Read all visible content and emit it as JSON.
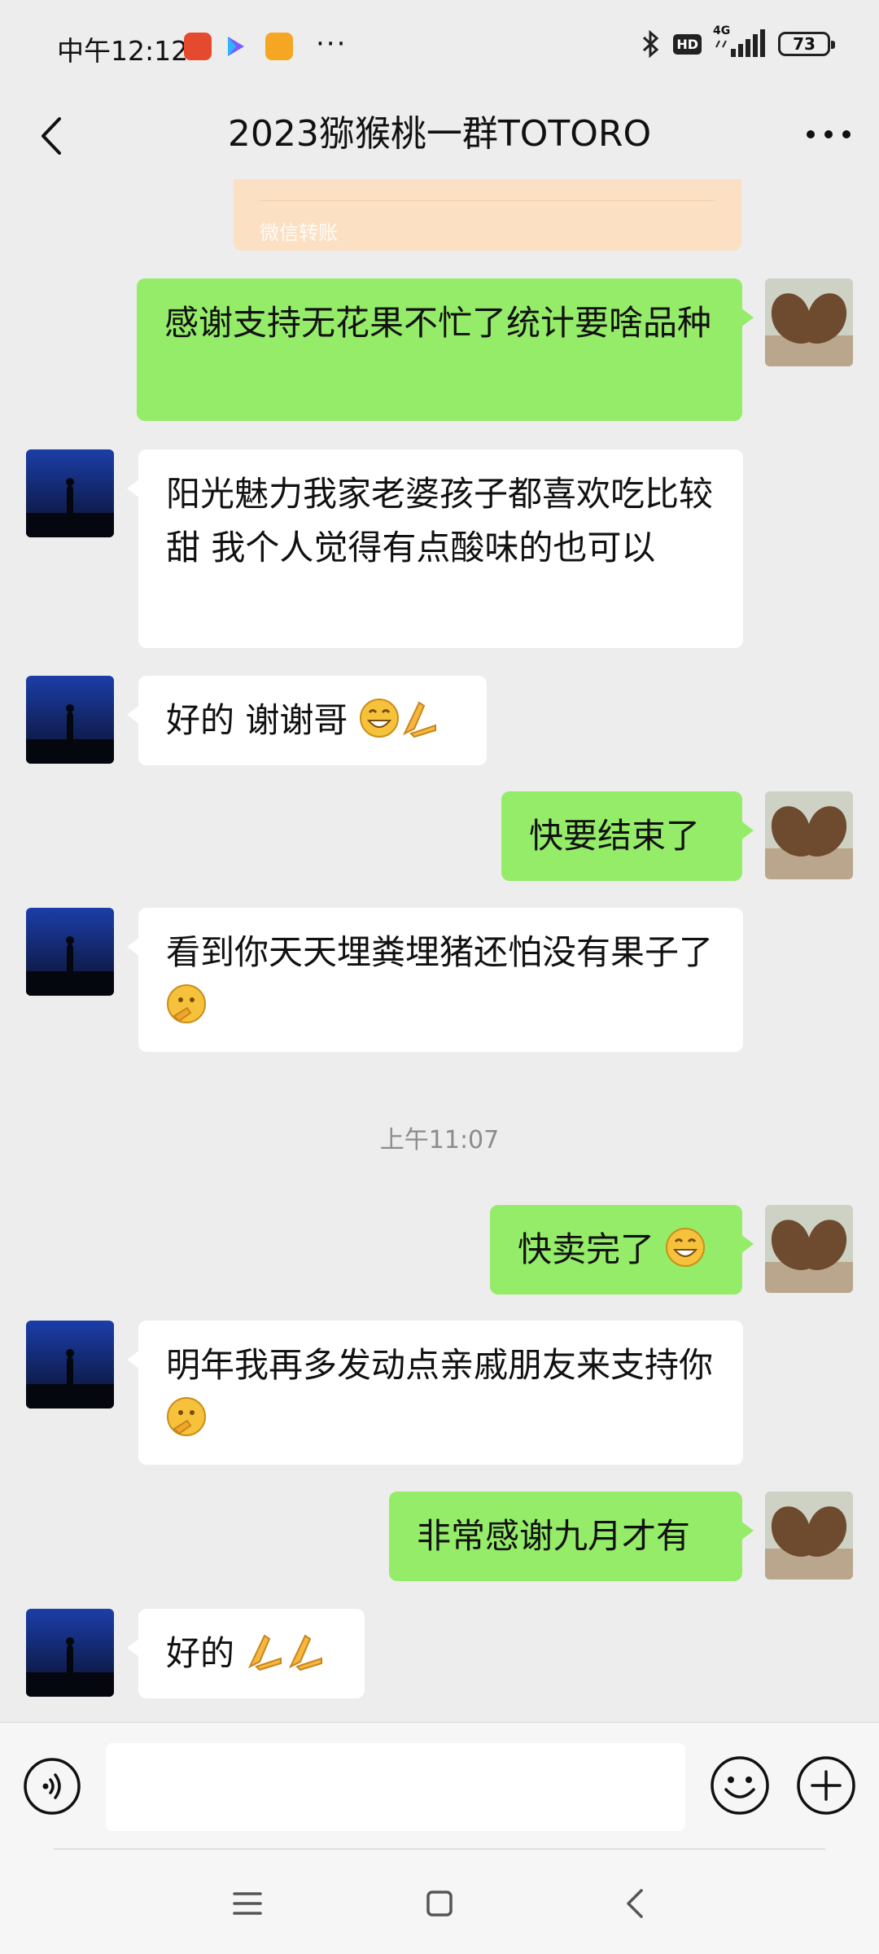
{
  "status_bar": {
    "time": "中午12:12",
    "battery": "73",
    "network": "4G",
    "hd_label": "HD"
  },
  "title_bar": {
    "title": "2023猕猴桃一群TOTORO"
  },
  "transfer_card": {
    "label": "微信转账",
    "color": "#fbe0c4"
  },
  "messages": [
    {
      "side": "me",
      "text": "感谢支持无花果不忙了统计要啥品种"
    },
    {
      "side": "them",
      "text": "阳光魅力我家老婆孩子都喜欢吃比较甜  我个人觉得有点酸味的也可以"
    },
    {
      "side": "them",
      "text": "好的 谢谢哥",
      "emojis": [
        "grin",
        "pray"
      ]
    },
    {
      "side": "me",
      "text": "快要结束了"
    },
    {
      "side": "them",
      "text": "看到你天天埋粪埋猪还怕没有果子了",
      "emojis": [
        "thinking-face"
      ]
    },
    {
      "side": "me",
      "text": "快卖完了",
      "emojis": [
        "grin"
      ]
    },
    {
      "side": "them",
      "text": "明年我再多发动点亲戚朋友来支持你",
      "emojis": [
        "thinking-face"
      ]
    },
    {
      "side": "me",
      "text": "非常感谢九月才有"
    },
    {
      "side": "them",
      "text": "好的",
      "emojis": [
        "pray",
        "pray"
      ]
    }
  ],
  "timestamp": "上午11:07",
  "colors": {
    "my_bubble": "#95ec69",
    "their_bubble": "#ffffff",
    "background": "#ededed"
  }
}
